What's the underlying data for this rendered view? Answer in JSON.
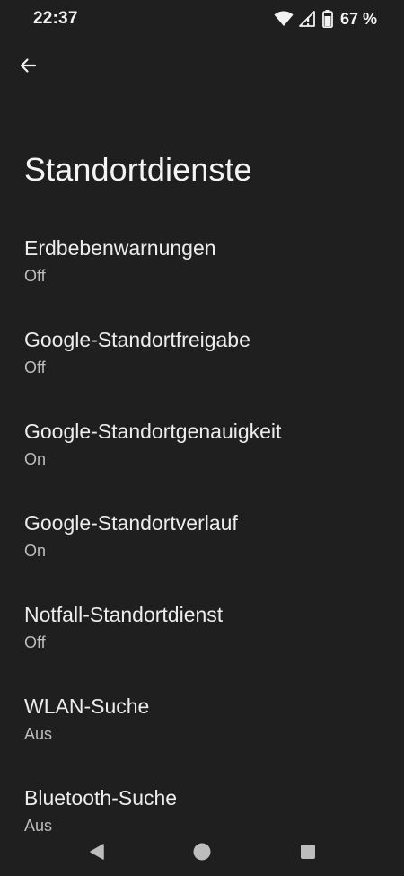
{
  "status_bar": {
    "time": "22:37",
    "battery_percent": "67 %",
    "icons": [
      "wifi-icon",
      "signal-icon",
      "battery-icon"
    ]
  },
  "header": {
    "back_icon": "arrow-back-icon",
    "title": "Standortdienste"
  },
  "items": [
    {
      "title": "Erdbebenwarnungen",
      "summary": "Off"
    },
    {
      "title": "Google-Standortfreigabe",
      "summary": "Off"
    },
    {
      "title": "Google-Standortgenauigkeit",
      "summary": "On"
    },
    {
      "title": "Google-Standortverlauf",
      "summary": "On"
    },
    {
      "title": "Notfall-Standortdienst",
      "summary": "Off"
    },
    {
      "title": "WLAN-Suche",
      "summary": "Aus"
    },
    {
      "title": "Bluetooth-Suche",
      "summary": "Aus"
    }
  ],
  "nav_bar": {
    "icons": [
      "back-triangle-icon",
      "home-circle-icon",
      "recents-square-icon"
    ]
  },
  "colors": {
    "background": "#1f1f1f",
    "title_text": "#ececec",
    "summary_text": "#bdbdbd"
  }
}
